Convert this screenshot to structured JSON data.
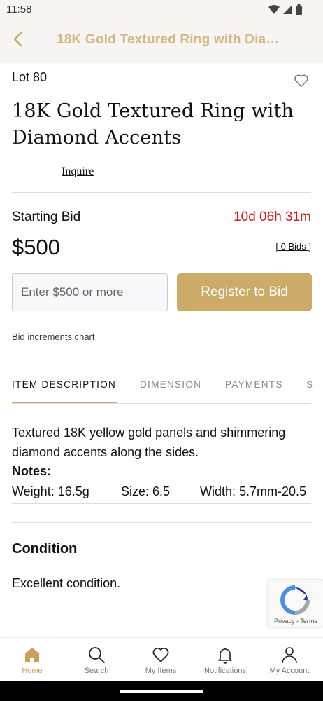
{
  "status": {
    "time": "11:58"
  },
  "header": {
    "title": "18K Gold Textured Ring with Dia…"
  },
  "lot": {
    "label": "Lot 80"
  },
  "item": {
    "title": "18K Gold Textured Ring with Diamond Accents",
    "inquire_label": "Inquire"
  },
  "bidding": {
    "starting_bid_label": "Starting Bid",
    "countdown": "10d 06h 31m",
    "price": "$500",
    "bids_count": "[ 0 Bids ]",
    "input_placeholder": "Enter $500 or more",
    "register_label": "Register to Bid",
    "increments_link": "Bid increments chart"
  },
  "tabs": [
    {
      "label": "ITEM DESCRIPTION"
    },
    {
      "label": "DIMENSION"
    },
    {
      "label": "PAYMENTS"
    },
    {
      "label": "S"
    }
  ],
  "description": {
    "text": "Textured 18K yellow gold panels and shimmering diamond accents along the sides.",
    "notes_label": "Notes:",
    "specs": [
      "Weight: 16.5g",
      "Size: 6.5",
      "Width: 5.7mm-20.5"
    ]
  },
  "condition": {
    "title": "Condition",
    "text": "Excellent condition."
  },
  "recaptcha": {
    "links": "Privacy - Terms"
  },
  "bottom_nav": [
    {
      "label": "Home",
      "icon": "home-icon"
    },
    {
      "label": "Search",
      "icon": "search-icon"
    },
    {
      "label": "My Items",
      "icon": "heart-icon"
    },
    {
      "label": "Notifications",
      "icon": "bell-icon"
    },
    {
      "label": "My Account",
      "icon": "user-icon"
    }
  ],
  "colors": {
    "accent": "#ccaa68",
    "header_text": "#d4b880",
    "countdown": "#d31818",
    "nav_active": "#c8a05a"
  }
}
